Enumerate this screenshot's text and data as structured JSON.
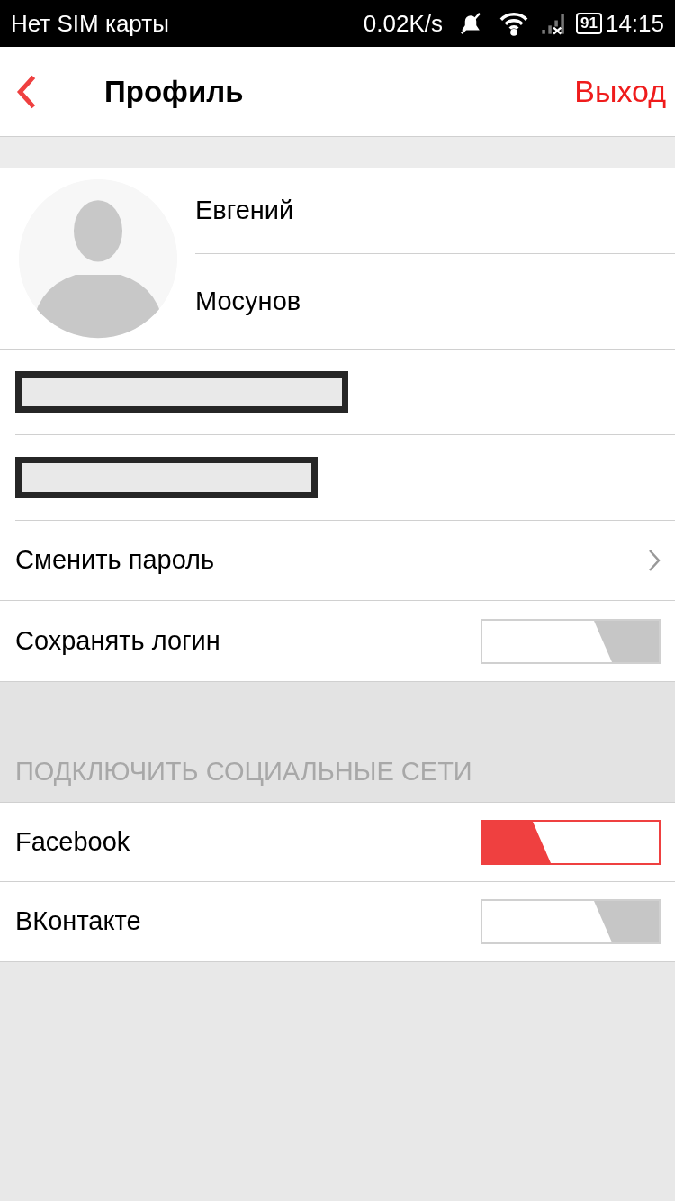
{
  "status_bar": {
    "carrier": "Нет SIM карты",
    "speed": "0.02K/s",
    "battery": "91",
    "time": "14:15"
  },
  "header": {
    "title": "Профиль",
    "action": "Выход"
  },
  "profile": {
    "first_name": "Евгений",
    "last_name": "Мосунов"
  },
  "fields": [
    {
      "kind": "redacted"
    },
    {
      "kind": "redacted"
    }
  ],
  "settings": [
    {
      "kind": "link",
      "label": "Сменить пароль"
    },
    {
      "kind": "toggle",
      "label": "Сохранять логин",
      "on": false
    }
  ],
  "social": {
    "heading": "ПОДКЛЮЧИТЬ СОЦИАЛЬНЫЕ СЕТИ",
    "items": [
      {
        "label": "Facebook",
        "on": true
      },
      {
        "label": "ВКонтакте",
        "on": false
      }
    ]
  }
}
